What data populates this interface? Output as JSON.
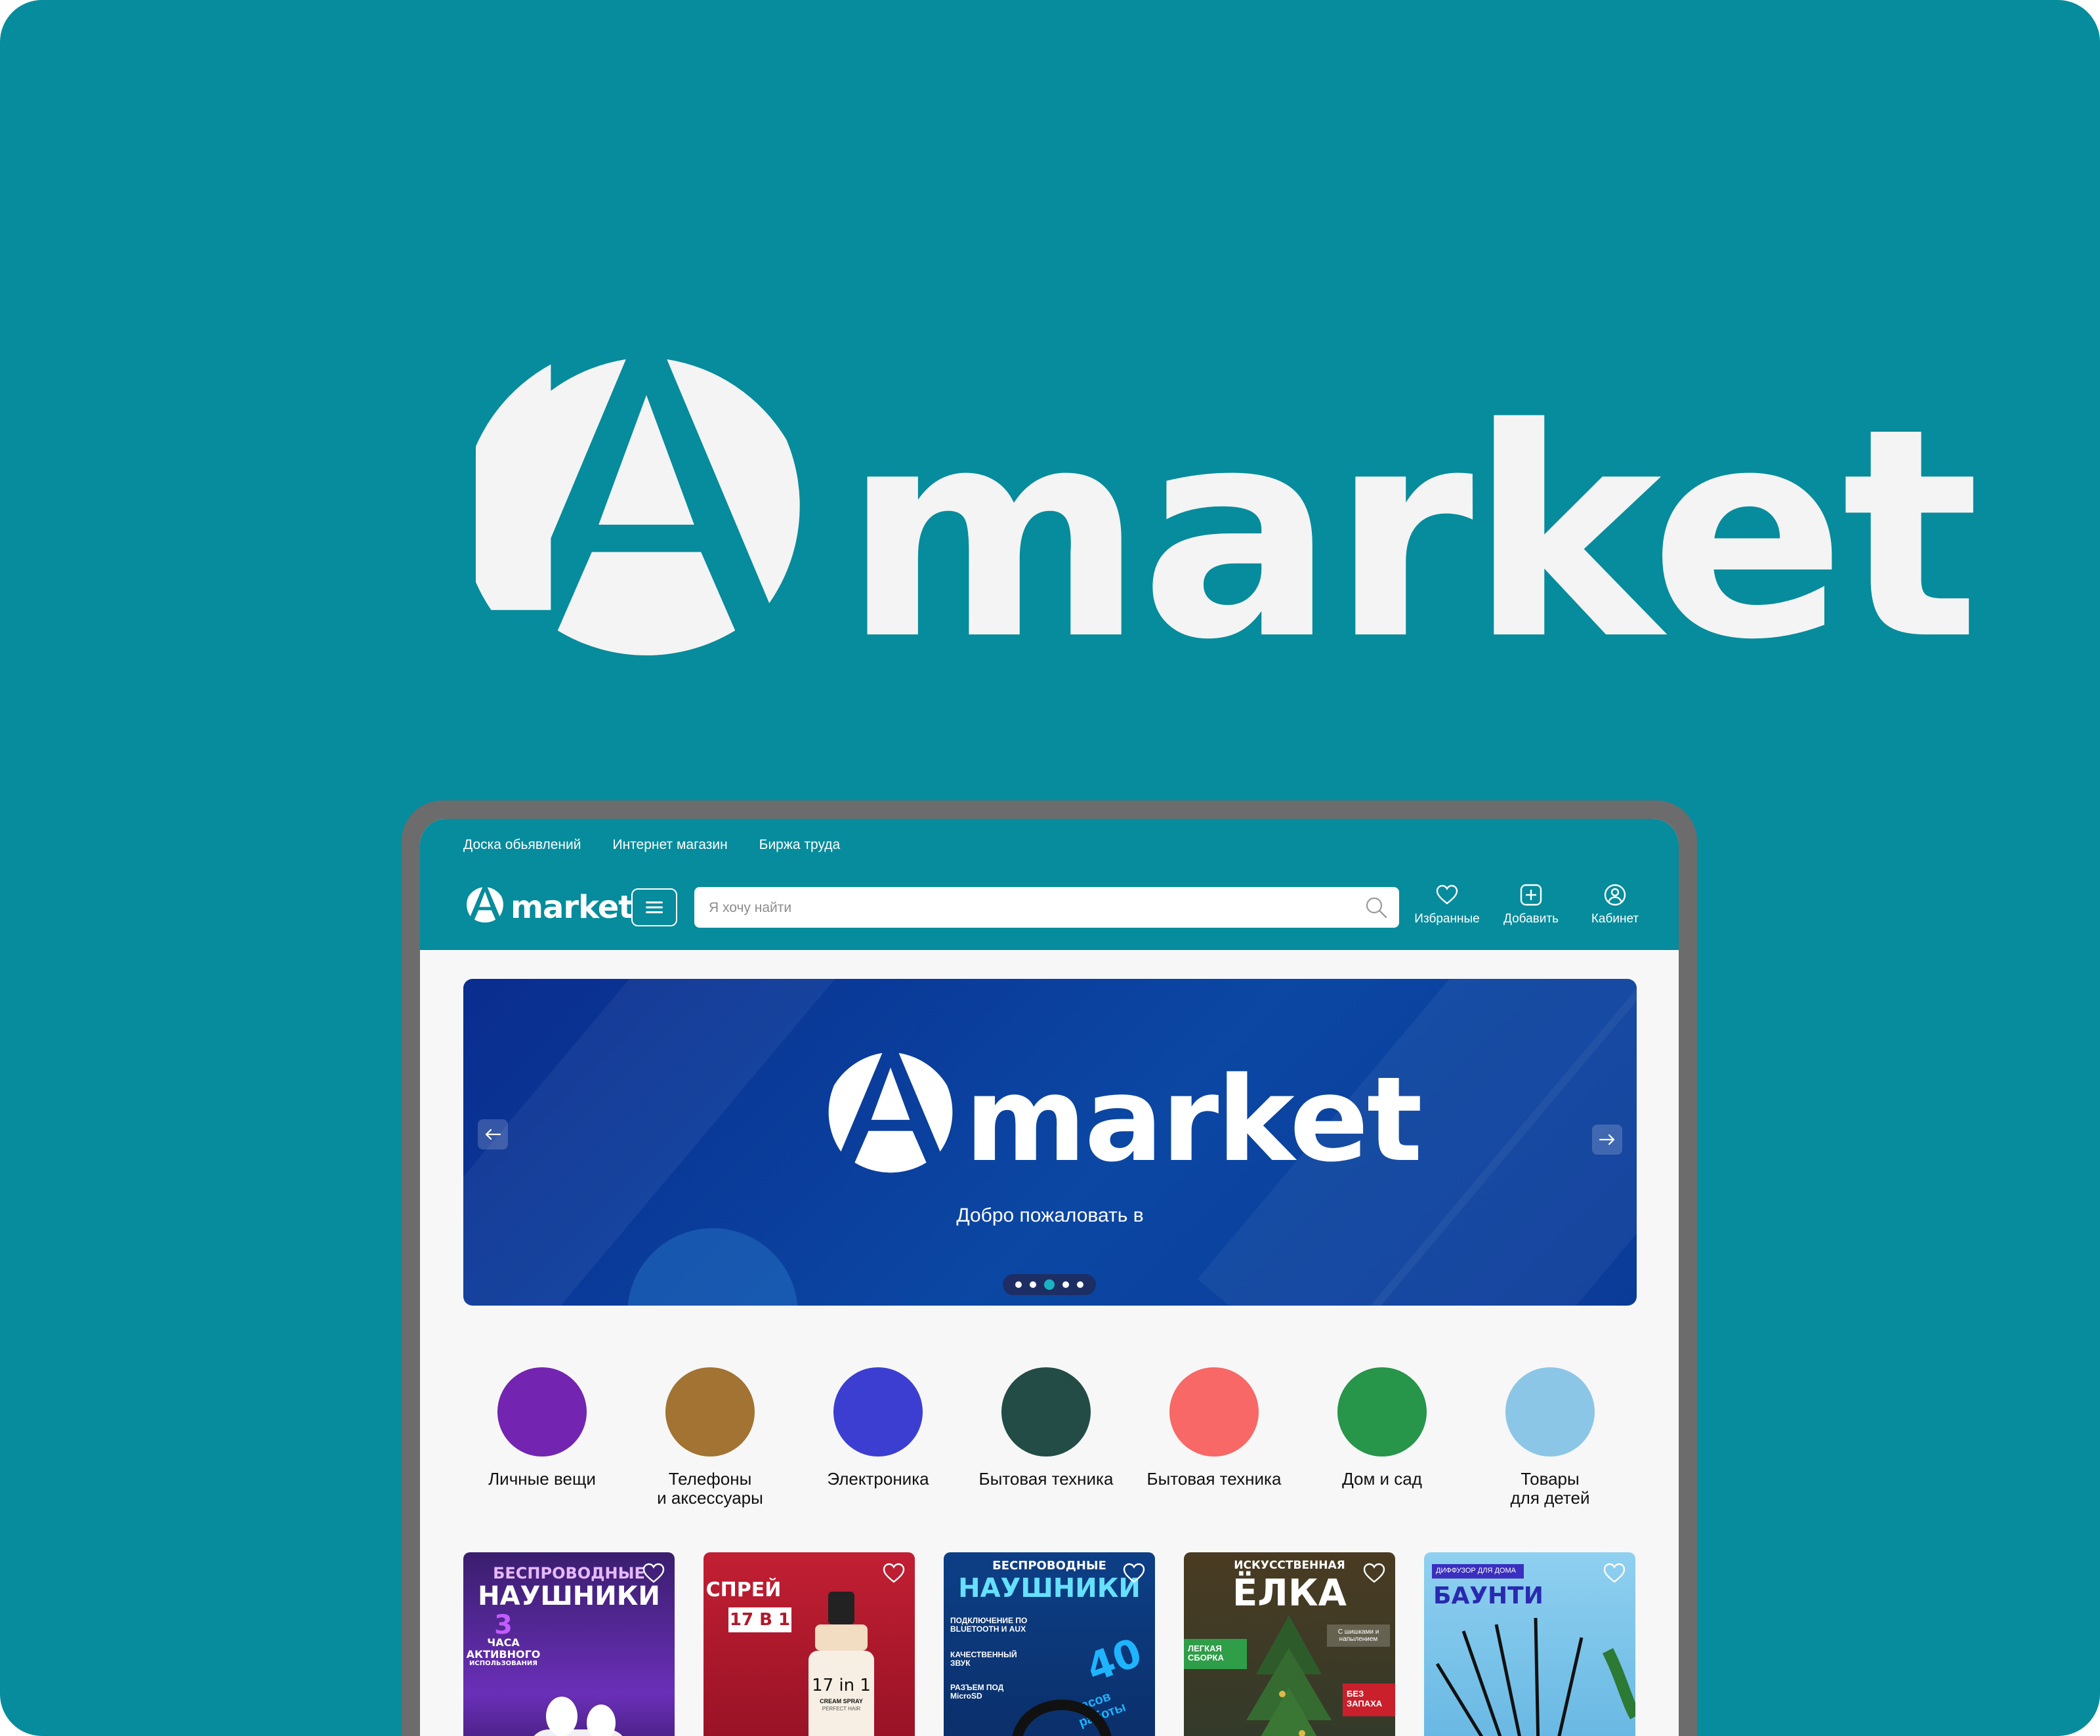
{
  "brand": {
    "wordmark": "market"
  },
  "colors": {
    "teal": "#068c9c",
    "frame": "#6c6c6c",
    "screen_bg": "#f7f7f7",
    "banner_blue": "#0b47a3",
    "white": "#ffffff"
  },
  "topnav": [
    "Доска обьявлений",
    "Интернет магазин",
    "Биржа труда"
  ],
  "header": {
    "menu_icon": "hamburger-icon",
    "search_placeholder": "Я хочу найти",
    "search_icon": "search-icon",
    "actions": [
      {
        "label": "Избранные",
        "icon": "heart-icon"
      },
      {
        "label": "Добавить",
        "icon": "plus-square-icon"
      },
      {
        "label": "Кабинет",
        "icon": "user-icon"
      }
    ]
  },
  "banner": {
    "wordmark": "market",
    "subtitle": "Добро пожаловать в",
    "prev_icon": "arrow-left-icon",
    "next_icon": "arrow-right-icon",
    "slides_count": 5,
    "active_slide": 3
  },
  "categories": [
    {
      "label": "Личные вещи",
      "color": "#7324b0"
    },
    {
      "label": "Телефоны\nи аксессуары",
      "color": "#a27332"
    },
    {
      "label": "Электроника",
      "color": "#3c3ed2"
    },
    {
      "label": "Бытовая техника",
      "color": "#234c46"
    },
    {
      "label": "Бытовая техника",
      "color": "#f76866"
    },
    {
      "label": "Дом и сад",
      "color": "#27954a"
    },
    {
      "label": "Товары\nдля детей",
      "color": "#8bc6e6"
    }
  ],
  "products": [
    {
      "lines": [
        "БЕСПРОВОДНЫЕ",
        "НАУШНИКИ",
        "3",
        "ЧАСА",
        "АКТИВНОГО",
        "ИСПОЛЬЗОВАНИЯ"
      ],
      "bg": "#3a1e6e",
      "icon": "heart-icon"
    },
    {
      "lines": [
        "СПРЕЙ",
        "17 В 1",
        "17 in 1",
        "CREAM SPRAY",
        "PERFECT HAIR"
      ],
      "bg": "#b2182b",
      "icon": "heart-icon"
    },
    {
      "lines": [
        "БЕСПРОВОДНЫЕ",
        "НАУШНИКИ",
        "ПОДКЛЮЧЕНИЕ ПО BLUETOOTH И AUX",
        "КАЧЕСТВЕННЫЙ ЗВУК",
        "РАЗЪЕМ ПОД MicroSD",
        "40",
        "часов работы"
      ],
      "bg": "#0d3f86",
      "icon": "heart-icon"
    },
    {
      "lines": [
        "ИСКУССТВЕННАЯ",
        "ЁЛКА",
        "ЛЕГКАЯ СБОРКА",
        "С шишками и напылением",
        "БЕЗ ЗАПАХА"
      ],
      "bg": "#5b4a2d",
      "icon": "heart-icon"
    },
    {
      "lines": [
        "ДИФФУЗОР ДЛЯ ДОМА",
        "БАУНТИ"
      ],
      "bg": "#7fc4e8",
      "icon": "heart-icon"
    }
  ]
}
